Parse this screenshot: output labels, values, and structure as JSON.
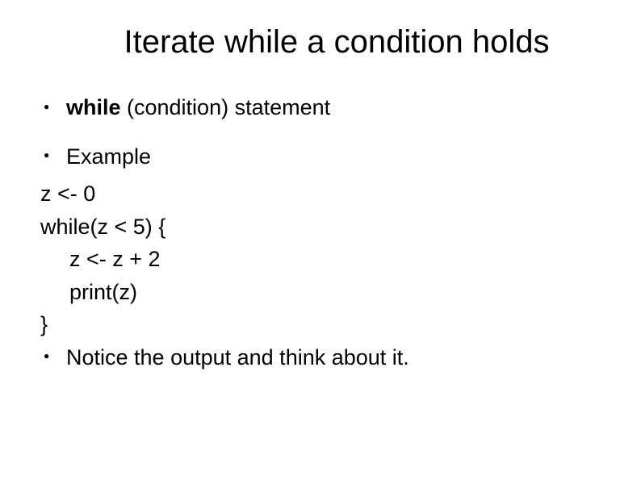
{
  "title": "Iterate while a condition holds",
  "bullet1": {
    "bold": "while",
    "rest": " (condition) statement"
  },
  "bullet2": "Example",
  "code": {
    "l1": "z <- 0",
    "l2": "while(z < 5) {",
    "l3": "z <- z + 2",
    "l4": "print(z)",
    "l5": "}"
  },
  "bullet3": "Notice the output and think about it."
}
